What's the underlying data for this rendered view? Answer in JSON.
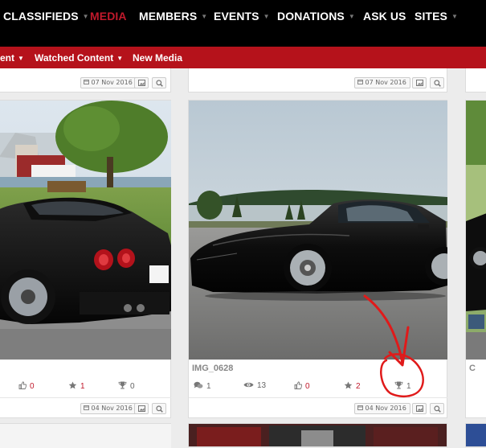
{
  "nav": {
    "items": [
      {
        "label": "CLASSIFIEDS",
        "dropdown": true
      },
      {
        "label": "MEDIA",
        "dropdown": false,
        "active": true
      },
      {
        "label": "MEMBERS",
        "dropdown": true
      },
      {
        "label": "EVENTS",
        "dropdown": true
      },
      {
        "label": "DONATIONS",
        "dropdown": true
      },
      {
        "label": "ASK US",
        "dropdown": false
      },
      {
        "label": "SITES",
        "dropdown": true
      }
    ],
    "active_color": "#c0192b"
  },
  "subnav": {
    "items": [
      {
        "label": "ent",
        "dropdown": true
      },
      {
        "label": "Watched Content",
        "dropdown": true
      },
      {
        "label": "New Media",
        "dropdown": false
      }
    ],
    "background": "#b5121b"
  },
  "cards": {
    "top_row": [
      {
        "date": "07 Nov 2016"
      },
      {
        "date": "07 Nov 2016"
      }
    ],
    "left": {
      "likes": "0",
      "rating": "1",
      "trophies": "0",
      "date": "04 Nov 2016"
    },
    "center": {
      "title": "IMG_0628",
      "comments": "1",
      "views": "13",
      "likes": "0",
      "rating": "2",
      "trophies": "1",
      "date": "04 Nov 2016"
    },
    "right": {
      "title_partial": "C"
    }
  },
  "annotation": {
    "color": "#e01a1a",
    "description": "red circle and arrow pointing at trophy count"
  }
}
